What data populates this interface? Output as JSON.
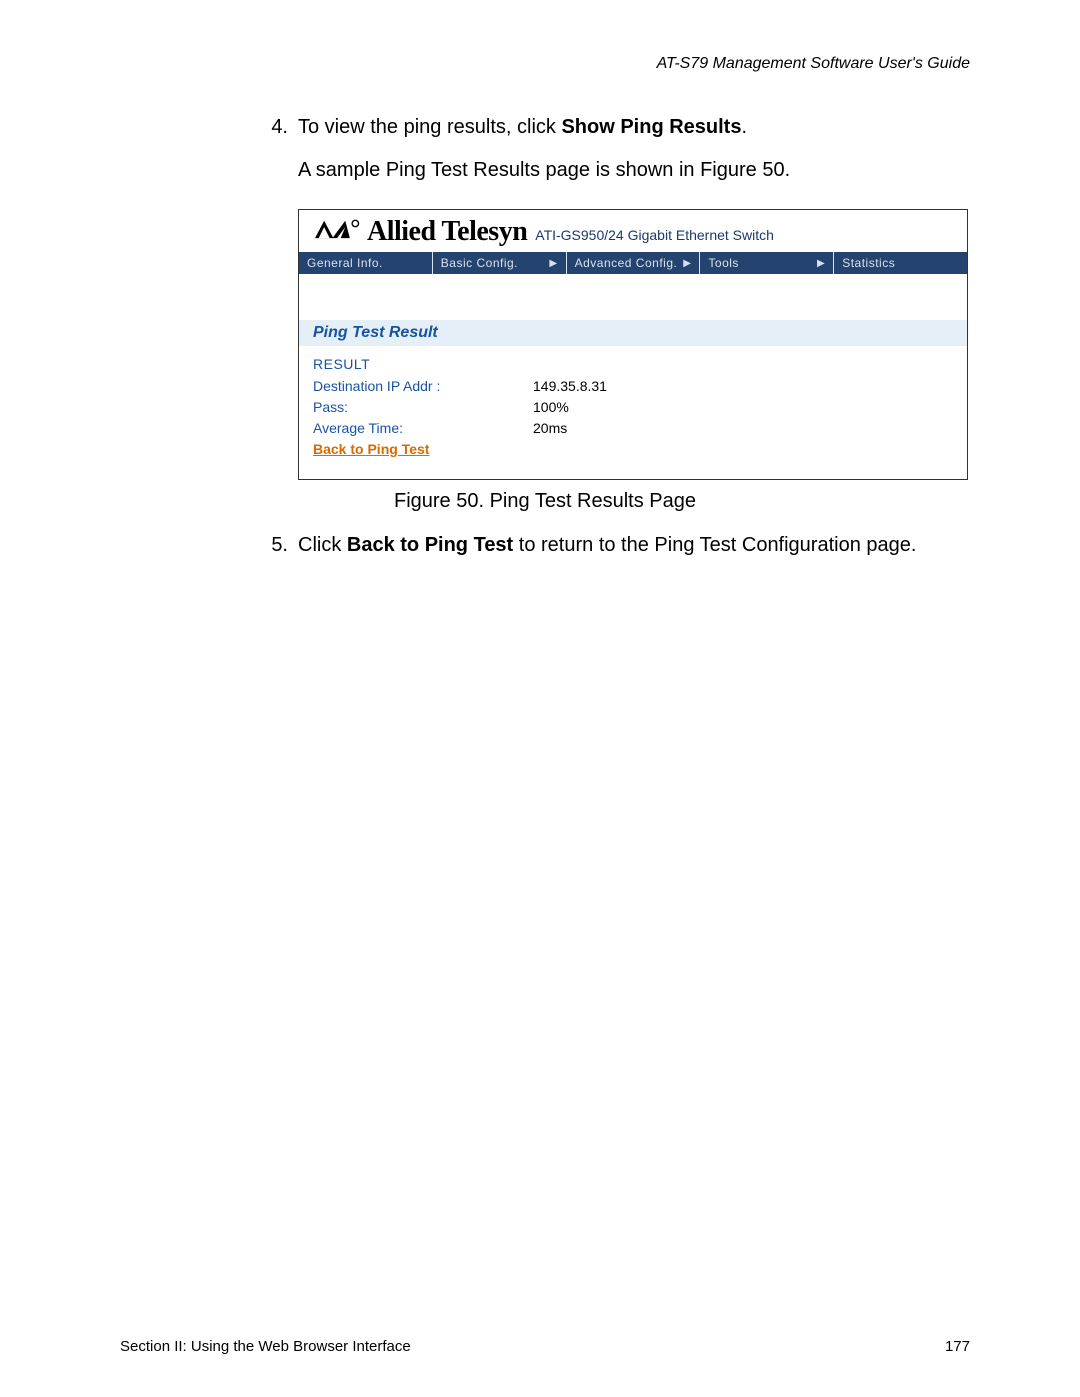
{
  "header": {
    "guide_title": "AT-S79 Management Software User's Guide"
  },
  "steps": {
    "s4": {
      "num": "4.",
      "prefix": "To view the ping results, click ",
      "bold": "Show Ping Results",
      "suffix": ".",
      "cont": "A sample Ping Test Results page is shown in Figure 50."
    },
    "s5": {
      "num": "5.",
      "prefix": "Click ",
      "bold": "Back to Ping Test",
      "suffix": " to return to the Ping Test Configuration page."
    }
  },
  "shot": {
    "brand_text": "Allied Telesyn",
    "product_sub": "ATI-GS950/24 Gigabit Ethernet Switch",
    "menu": {
      "m1": "General Info.",
      "m2": "Basic Config.",
      "m3": "Advanced Config.",
      "m4": "Tools",
      "m5": "Statistics"
    },
    "panel_title": "Ping Test Result",
    "result_heading": "RESULT",
    "rows": {
      "r1": {
        "label": "Destination IP Addr :",
        "value": "149.35.8.31"
      },
      "r2": {
        "label": "Pass:",
        "value": "100%"
      },
      "r3": {
        "label": "Average Time:",
        "value": "20ms"
      }
    },
    "back_link": "Back to Ping Test"
  },
  "figure_caption": "Figure 50. Ping Test Results Page",
  "footer": {
    "section": "Section II: Using the Web Browser Interface",
    "page_num": "177"
  }
}
